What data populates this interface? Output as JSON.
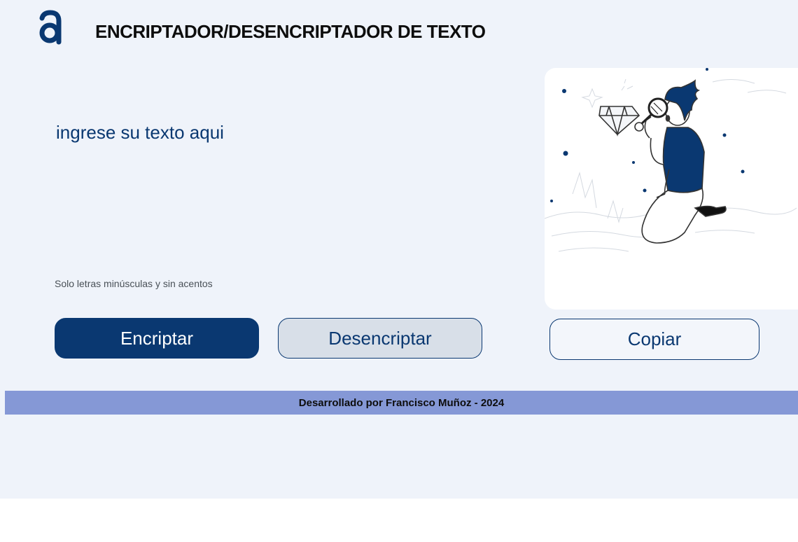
{
  "header": {
    "logo_letter": "a",
    "title": "ENCRIPTADOR/DESENCRIPTADOR DE TEXTO"
  },
  "input": {
    "placeholder": "ingrese su texto aqui",
    "value": ""
  },
  "hint": "Solo letras minúsculas y sin acentos",
  "buttons": {
    "encrypt": "Encriptar",
    "decrypt": "Desencriptar",
    "copy": "Copiar"
  },
  "illustration": {
    "icon": "person-with-magnifier-illustration"
  },
  "footer": {
    "text": "Desarrollado por Francisco Muñoz - 2024"
  },
  "colors": {
    "primary": "#0a3871",
    "background": "#eff3fa",
    "footer": "#8598d6"
  }
}
